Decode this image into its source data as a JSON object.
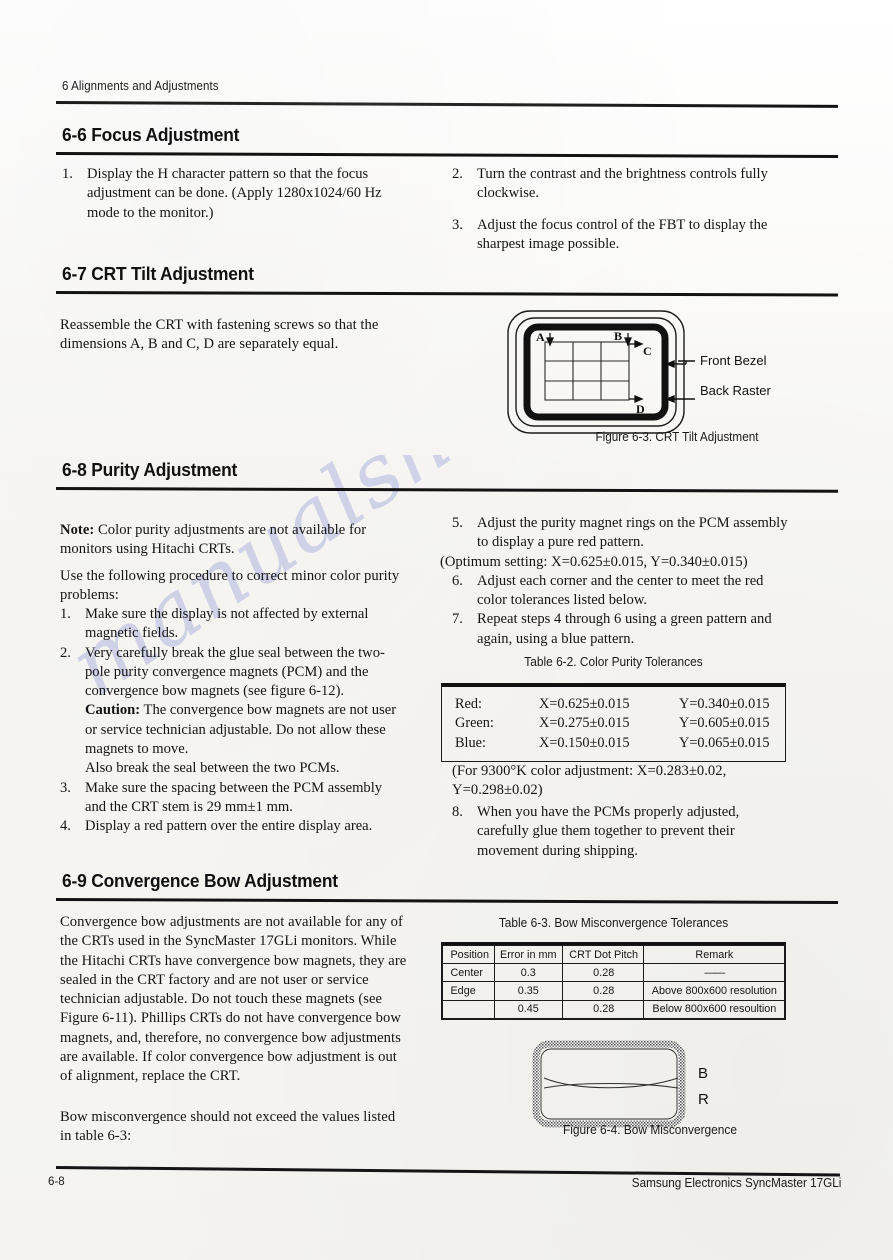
{
  "page": {
    "running_head": "6 Alignments and Adjustments",
    "footer_page_number": "6-8",
    "footer_right": "Samsung Electronics SyncMaster 17GLi",
    "watermark": "manualshive.com"
  },
  "sections": {
    "focus": {
      "heading": "6-6 Focus Adjustment",
      "steps_left": [
        {
          "num": "1.",
          "text": "Display the H character pattern so that the focus adjustment can be done. (Apply 1280x1024/60 Hz mode to the monitor.)"
        }
      ],
      "steps_right": [
        {
          "num": "2.",
          "text": "Turn the contrast and the brightness controls fully clockwise."
        },
        {
          "num": "3.",
          "text": "Adjust the focus control of the FBT to display the sharpest image possible."
        }
      ]
    },
    "crt_tilt": {
      "heading": "6-7 CRT Tilt Adjustment",
      "paragraph": "Reassemble the CRT with fastening screws so that the dimensions A, B and C, D are separately equal.",
      "figure": {
        "caption": "Figure 6-3. CRT Tilt Adjustment",
        "label_a": "A",
        "label_b": "B",
        "label_c": "C",
        "label_d": "D",
        "callout_front": "Front Bezel",
        "callout_back": "Back Raster"
      }
    },
    "purity": {
      "heading": "6-8 Purity Adjustment",
      "note_label": "Note:",
      "note_text": " Color purity adjustments are not available for monitors using Hitachi CRTs.",
      "intro": "Use the following procedure to correct minor color purity problems:",
      "steps_left": [
        {
          "num": "1.",
          "text": "Make sure the display is not affected by external magnetic fields."
        },
        {
          "num": "2.",
          "text": "Very carefully break the glue seal between the two-pole purity convergence magnets (PCM) and the convergence bow magnets (see figure 6-12)."
        }
      ],
      "caution_label": "Caution:",
      "caution_text": " The convergence bow magnets are not user or service technician adjustable. Do not allow these magnets to move.",
      "also_break": "Also break the seal between the two PCMs.",
      "steps_left_cont": [
        {
          "num": "3.",
          "text": "Make sure the spacing between the PCM assembly and the CRT stem is 29 mm±1 mm."
        },
        {
          "num": "4.",
          "text": "Display a red pattern over the entire display area."
        }
      ],
      "steps_right": [
        {
          "num": "5.",
          "text": "Adjust the purity magnet rings on the PCM assembly to display a pure red pattern."
        }
      ],
      "optimum_setting": "(Optimum setting: X=0.625±0.015, Y=0.340±0.015)",
      "steps_right_cont": [
        {
          "num": "6.",
          "text": "Adjust each corner and the center to meet the red color tolerances listed below."
        },
        {
          "num": "7.",
          "text": "Repeat steps 4 through 6 using a green pattern and again, using a blue pattern."
        }
      ],
      "step8": {
        "num": "8.",
        "text": "When you have the PCMs properly adjusted, carefully glue them together to prevent their movement during shipping."
      },
      "color_temp_note": "(For 9300°K color adjustment: X=0.283±0.02, Y=0.298±0.02)",
      "table": {
        "caption": "Table 6-2. Color Purity Tolerances",
        "rows": [
          {
            "color": "Red:",
            "x": "X=0.625±0.015",
            "y": "Y=0.340±0.015"
          },
          {
            "color": "Green:",
            "x": "X=0.275±0.015",
            "y": "Y=0.605±0.015"
          },
          {
            "color": "Blue:",
            "x": "X=0.150±0.015",
            "y": "Y=0.065±0.015"
          }
        ]
      }
    },
    "convergence_bow": {
      "heading": "6-9 Convergence Bow Adjustment",
      "paragraph": "Convergence bow adjustments are not available for any of the CRTs used in the SyncMaster 17GLi monitors. While the Hitachi CRTs have convergence bow magnets, they are sealed in the CRT factory and are not user or service technician adjustable. Do not touch these magnets (see Figure 6-11). Phillips CRTs do not have convergence bow magnets, and, therefore, no convergence bow adjustments are available. If color convergence bow adjustment is out of alignment, replace the CRT.",
      "paragraph2": "Bow misconvergence should not exceed the values listed in table 6-3:",
      "table": {
        "caption": "Table 6-3. Bow Misconvergence Tolerances",
        "headers": [
          "Position",
          "Error in mm",
          "CRT Dot Pitch",
          "Remark"
        ],
        "rows": [
          [
            "Center",
            "0.3",
            "0.28",
            "——"
          ],
          [
            "Edge",
            "0.35",
            "0.28",
            "Above 800x600 resolution"
          ],
          [
            "",
            "0.45",
            "0.28",
            "Below 800x600 resoultion"
          ]
        ]
      },
      "figure": {
        "caption": "Figure 6-4. Bow Misconvergence",
        "label_b": "B",
        "label_r": "R"
      }
    }
  }
}
